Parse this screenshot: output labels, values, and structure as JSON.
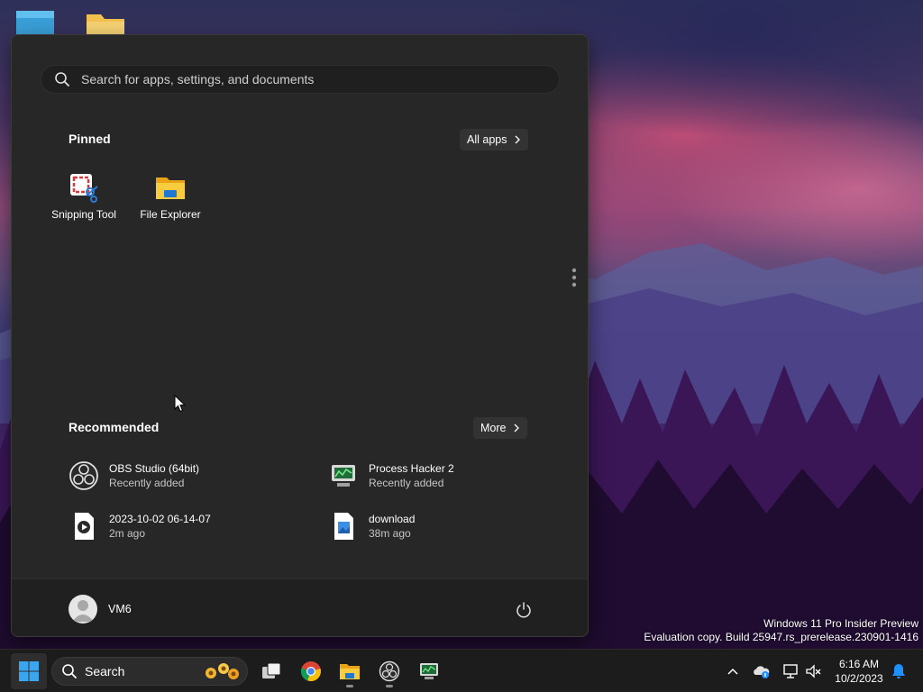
{
  "desktop": {
    "watermark_line1": "Windows 11 Pro Insider Preview",
    "watermark_line2": "Evaluation copy. Build 25947.rs_prerelease.230901-1416"
  },
  "start_menu": {
    "search_placeholder": "Search for apps, settings, and documents",
    "pinned_title": "Pinned",
    "all_apps_label": "All apps",
    "pinned_apps": [
      {
        "label": "Snipping Tool",
        "icon": "snipping-tool-icon"
      },
      {
        "label": "File Explorer",
        "icon": "file-explorer-icon"
      }
    ],
    "recommended_title": "Recommended",
    "more_label": "More",
    "recommended": [
      {
        "name": "OBS Studio (64bit)",
        "sub": "Recently added",
        "icon": "obs-icon"
      },
      {
        "name": "Process Hacker 2",
        "sub": "Recently added",
        "icon": "process-hacker-icon"
      },
      {
        "name": "2023-10-02 06-14-07",
        "sub": "2m ago",
        "icon": "video-file-icon"
      },
      {
        "name": "download",
        "sub": "38m ago",
        "icon": "image-file-icon"
      }
    ],
    "user_name": "VM6"
  },
  "taskbar": {
    "search_label": "Search",
    "time": "6:16 AM",
    "date": "10/2/2023"
  },
  "colors": {
    "menu_bg": "#272727",
    "footer_bg": "#202020",
    "taskbar_bg": "#1c1c1c",
    "accent_blue": "#1e90ff"
  }
}
